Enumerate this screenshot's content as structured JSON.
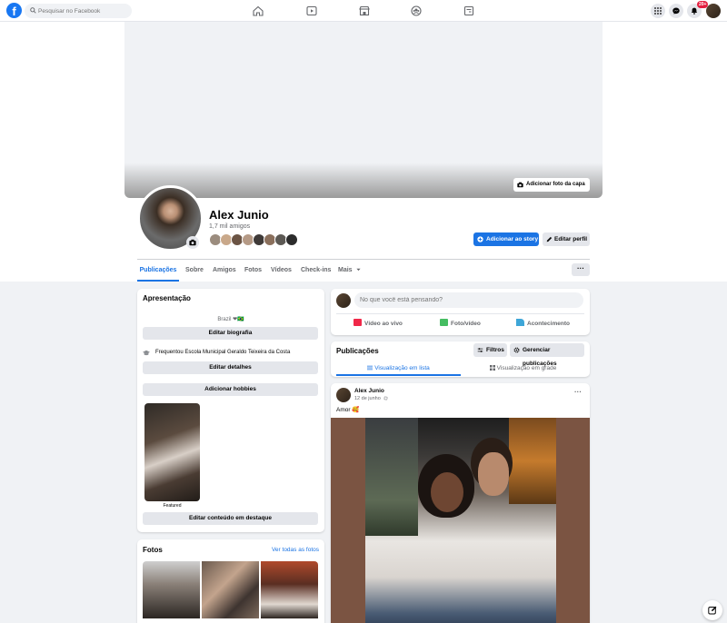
{
  "topbar": {
    "logo": "f",
    "search_placeholder": "Pesquisar no Facebook",
    "nav_icons": [
      "home-icon",
      "watch-icon",
      "marketplace-icon",
      "groups-icon",
      "gaming-icon"
    ],
    "notifications_badge": "20+"
  },
  "cover": {
    "add_cover_label": "Adicionar foto da capa"
  },
  "profile": {
    "name": "Alex Junio",
    "friends_count": "1,7 mil amigos",
    "add_story_label": "Adicionar ao story",
    "edit_profile_label": "Editar perfil"
  },
  "tabs": [
    "Publicações",
    "Sobre",
    "Amigos",
    "Fotos",
    "Vídeos",
    "Check-ins",
    "Mais"
  ],
  "tabs_more": "···",
  "intro": {
    "title": "Apresentação",
    "bio": "Brazil ❤🇧🇷",
    "edit_bio": "Editar biografia",
    "education": "Frequentou Escola Municipal Geraldo Teixeira da Costa",
    "edit_details": "Editar detalhes",
    "add_hobbies": "Adicionar hobbies",
    "featured_label": "Featured",
    "edit_featured": "Editar conteúdo em destaque"
  },
  "photos": {
    "title": "Fotos",
    "see_all": "Ver todas as fotos"
  },
  "composer": {
    "placeholder": "No que você está pensando?",
    "live_video": "Vídeo ao vivo",
    "photo_video": "Foto/vídeo",
    "event": "Acontecimento"
  },
  "posts_panel": {
    "title": "Publicações",
    "filters": "Filtros",
    "manage": "Gerenciar publicações",
    "list_view": "Visualização em lista",
    "grid_view": "Visualização em grade"
  },
  "post": {
    "author": "Alex Junio",
    "date": "12 de junho",
    "text": "Amor 🥰",
    "menu": "···"
  },
  "colors": {
    "brand": "#1877f2",
    "accent": "#1b74e4",
    "page_bg": "#f0f2f5",
    "badge": "#e41e3f"
  }
}
